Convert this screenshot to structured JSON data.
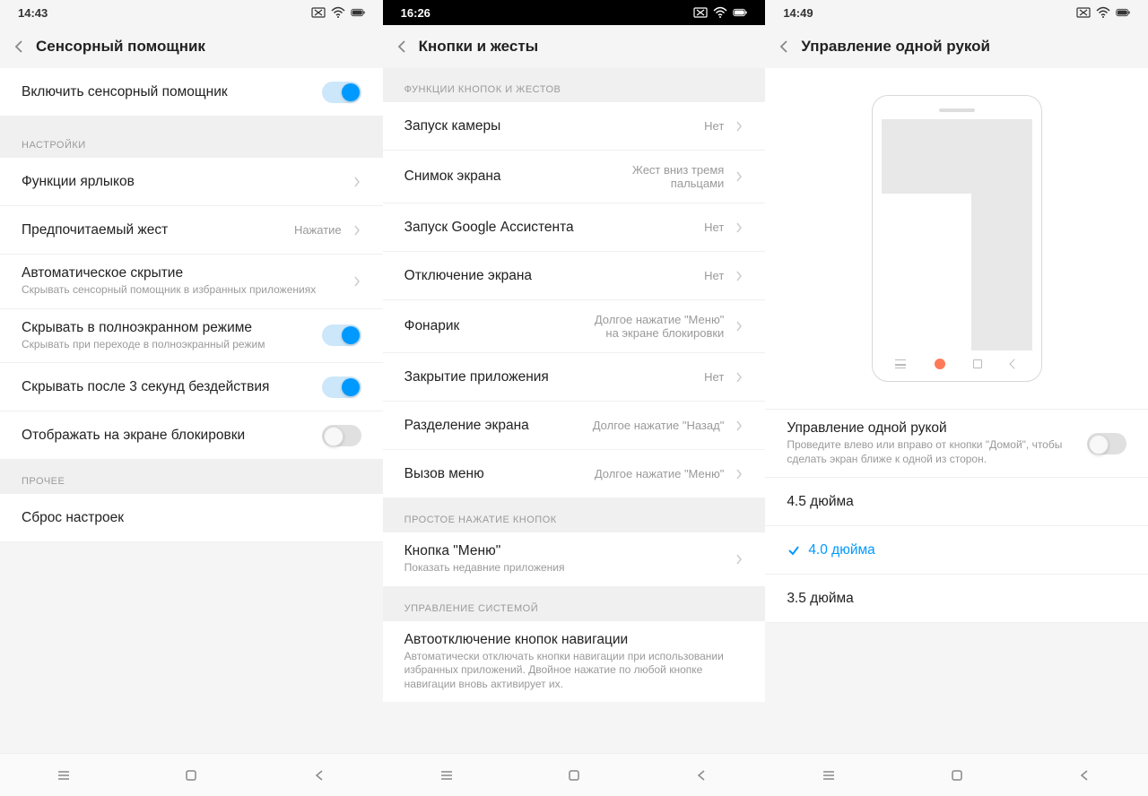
{
  "screen1": {
    "status_time": "14:43",
    "title": "Сенсорный помощник",
    "enable_row": "Включить сенсорный помощник",
    "section_settings": "НАСТРОЙКИ",
    "shortcut_functions": "Функции ярлыков",
    "preferred_gesture": "Предпочитаемый жест",
    "preferred_gesture_value": "Нажатие",
    "auto_hide": "Автоматическое скрытие",
    "auto_hide_sub": "Скрывать сенсорный помощник в избранных приложениях",
    "hide_fullscreen": "Скрывать в полноэкранном режиме",
    "hide_fullscreen_sub": "Скрывать при переходе в полноэкранный режим",
    "hide_3sec": "Скрывать после 3 секунд бездействия",
    "show_lockscreen": "Отображать на экране блокировки",
    "section_other": "ПРОЧЕЕ",
    "reset": "Сброс настроек"
  },
  "screen2": {
    "status_time": "16:26",
    "title": "Кнопки и жесты",
    "section_functions": "ФУНКЦИИ КНОПОК И ЖЕСТОВ",
    "items": [
      {
        "label": "Запуск камеры",
        "value": "Нет"
      },
      {
        "label": "Снимок экрана",
        "value": "Жест вниз тремя пальцами"
      },
      {
        "label": "Запуск Google Ассистента",
        "value": "Нет"
      },
      {
        "label": "Отключение экрана",
        "value": "Нет"
      },
      {
        "label": "Фонарик",
        "value": "Долгое нажатие \"Меню\" на экране блокировки"
      },
      {
        "label": "Закрытие приложения",
        "value": "Нет"
      },
      {
        "label": "Разделение экрана",
        "value": "Долгое нажатие \"Назад\""
      },
      {
        "label": "Вызов меню",
        "value": "Долгое нажатие \"Меню\""
      }
    ],
    "section_simple_tap": "ПРОСТОЕ НАЖАТИЕ КНОПОК",
    "menu_button": "Кнопка \"Меню\"",
    "menu_button_sub": "Показать недавние приложения",
    "section_system": "УПРАВЛЕНИЕ СИСТЕМОЙ",
    "auto_disable": "Автоотключение кнопок навигации",
    "auto_disable_sub": "Автоматически отключать кнопки навигации при использовании избранных приложений. Двойное нажатие по любой кнопке навигации вновь активирует их."
  },
  "screen3": {
    "status_time": "14:49",
    "title": "Управление одной рукой",
    "one_hand": "Управление одной рукой",
    "one_hand_sub": "Проведите влево или вправо от кнопки \"Домой\", чтобы сделать экран ближе к одной из сторон.",
    "opt_45": "4.5 дюйма",
    "opt_40": "4.0 дюйма",
    "opt_35": "3.5 дюйма"
  }
}
